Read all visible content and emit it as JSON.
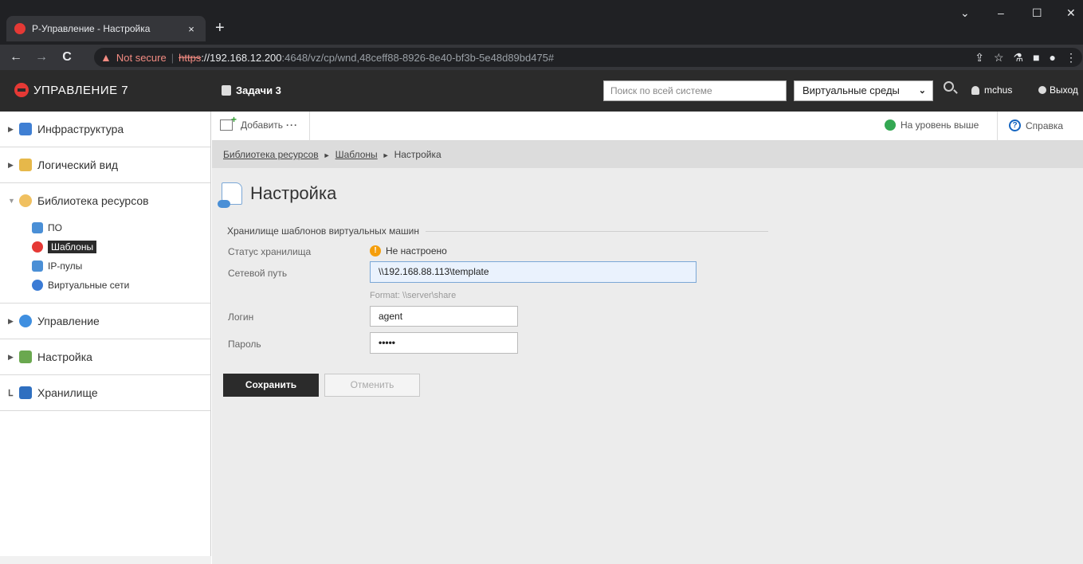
{
  "browser": {
    "tab_title": "Р-Управление - Настройка",
    "tab_close": "×",
    "new_tab": "+",
    "controls": {
      "chevron": "⌄",
      "minimize": "–",
      "maximize": "☐",
      "close": "✕"
    },
    "nav": {
      "back": "←",
      "forward": "→",
      "reload": "C"
    },
    "not_secure": "Not secure",
    "url_scheme": "https",
    "url_host": "://192.168.12.200",
    "url_rest": ":4648/vz/cp/wnd,48ceff88-8926-8e40-bf3b-5e48d89bd475#"
  },
  "header": {
    "logo": "УПРАВЛЕНИЕ 7",
    "tasks": "Задачи 3",
    "search_placeholder": "Поиск по всей системе",
    "env_select": "Виртуальные среды",
    "user": "mchus",
    "logout": "Выход"
  },
  "sidebar": {
    "items": [
      {
        "label": "Инфраструктура",
        "icon": "infrastructure-icon",
        "color": "#3f7fd3"
      },
      {
        "label": "Логический вид",
        "icon": "folder-icon",
        "color": "#e6b84a"
      },
      {
        "label": "Библиотека ресурсов",
        "icon": "library-icon",
        "color": "#f0c060"
      },
      {
        "label": "Управление",
        "icon": "gear-icon",
        "color": "#3f8fe0"
      },
      {
        "label": "Настройка",
        "icon": "tools-icon",
        "color": "#6aa84f"
      },
      {
        "label": "Хранилище",
        "icon": "storage-icon",
        "color": "#2f6fc0"
      }
    ],
    "library_children": [
      {
        "label": "ПО",
        "icon": "software-icon",
        "color": "#4a8fd6"
      },
      {
        "label": "Шаблоны",
        "icon": "templates-icon",
        "color": "#e53935"
      },
      {
        "label": "IP-пулы",
        "icon": "ip-pool-icon",
        "color": "#4a8fd6"
      },
      {
        "label": "Виртуальные сети",
        "icon": "virtual-network-icon",
        "color": "#3a7bd5"
      }
    ]
  },
  "toolbar": {
    "add": "Добавить",
    "more": "···",
    "level_up": "На уровень выше",
    "help": "Справка"
  },
  "breadcrumb": {
    "items": [
      "Библиотека ресурсов",
      "Шаблоны",
      "Настройка"
    ],
    "separator": "►"
  },
  "page": {
    "title": "Настройка",
    "section": "Хранилище шаблонов виртуальных машин",
    "status_label": "Статус хранилища",
    "status_value": "Не настроено",
    "path_label": "Сетевой путь",
    "path_value": "\\\\192.168.88.113\\template",
    "path_hint": "Format: \\\\server\\share",
    "login_label": "Логин",
    "login_value": "agent",
    "password_label": "Пароль",
    "password_value": "•••••",
    "save": "Сохранить",
    "cancel": "Отменить"
  }
}
